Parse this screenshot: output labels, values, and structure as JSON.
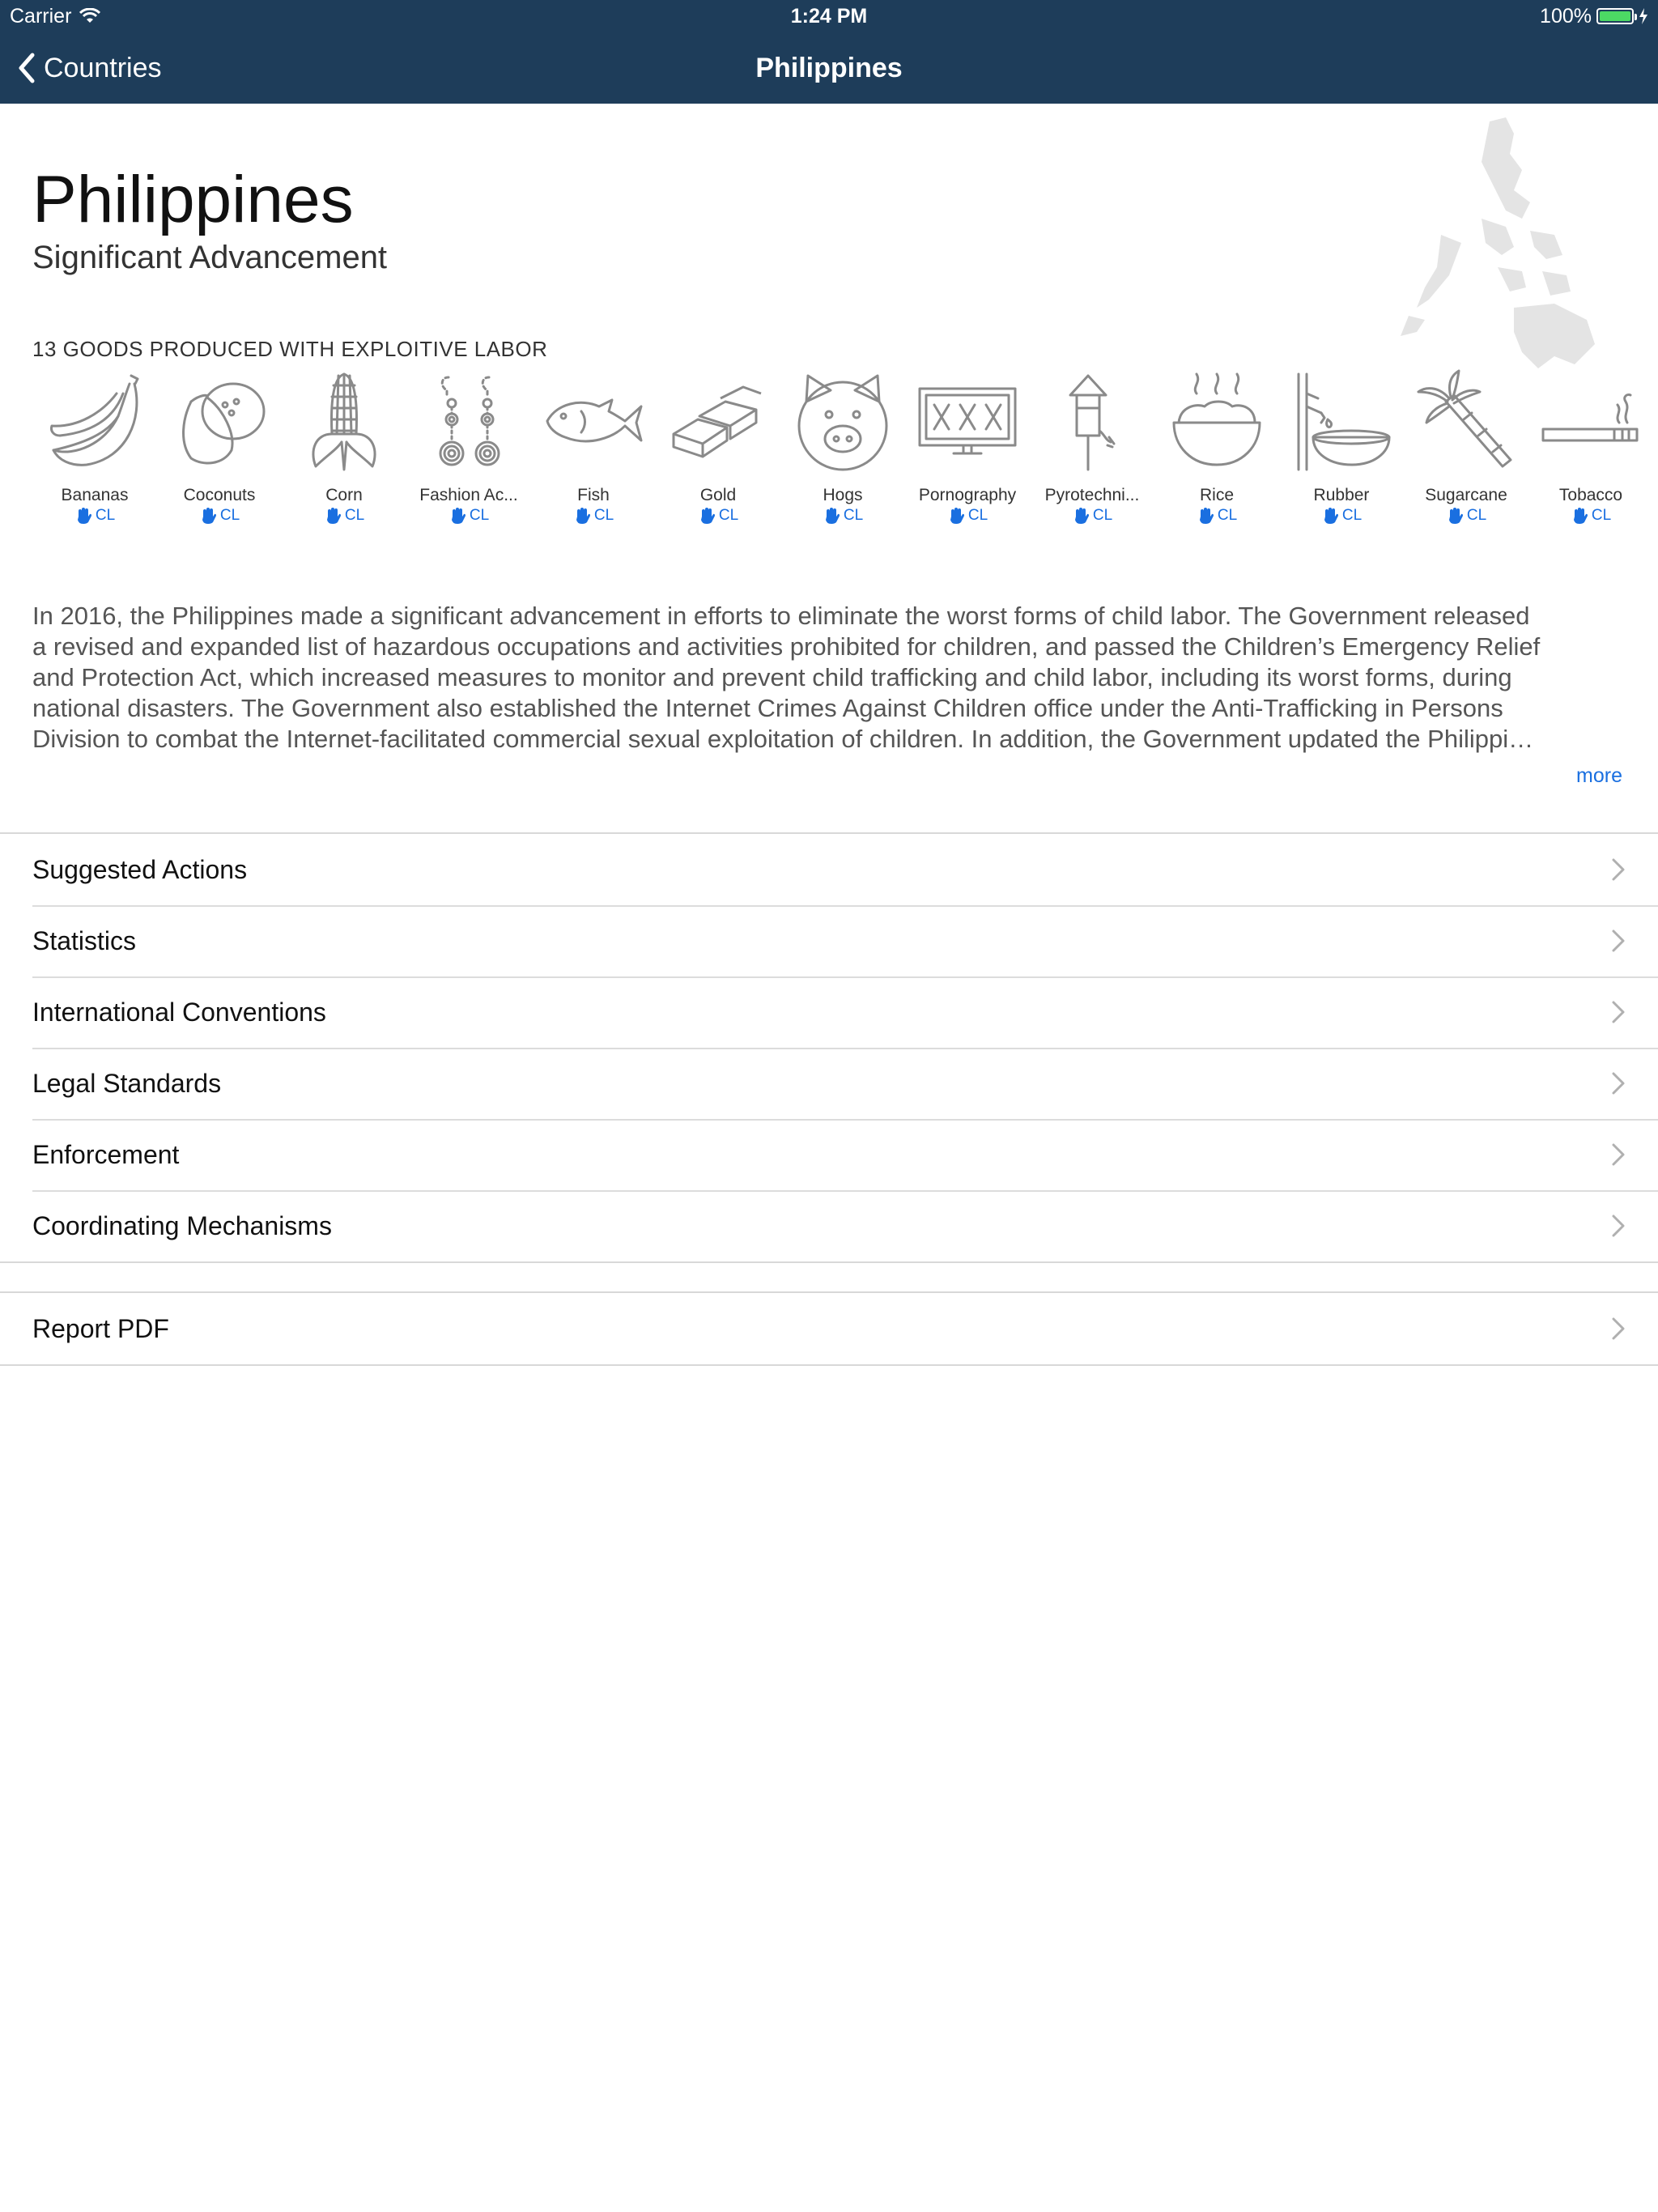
{
  "status_bar": {
    "carrier": "Carrier",
    "time": "1:24 PM",
    "battery": "100%"
  },
  "nav": {
    "back_label": "Countries",
    "title": "Philippines"
  },
  "country": {
    "name": "Philippines",
    "assessment": "Significant Advancement",
    "goods_heading": "13 GOODS PRODUCED WITH EXPLOITIVE LABOR"
  },
  "goods": [
    {
      "label": "Bananas",
      "badge": "CL",
      "icon": "banana-icon"
    },
    {
      "label": "Coconuts",
      "badge": "CL",
      "icon": "coconut-icon"
    },
    {
      "label": "Corn",
      "badge": "CL",
      "icon": "corn-icon"
    },
    {
      "label": "Fashion Ac...",
      "badge": "CL",
      "icon": "earrings-icon"
    },
    {
      "label": "Fish",
      "badge": "CL",
      "icon": "fish-icon"
    },
    {
      "label": "Gold",
      "badge": "CL",
      "icon": "gold-bars-icon"
    },
    {
      "label": "Hogs",
      "badge": "CL",
      "icon": "pig-icon"
    },
    {
      "label": "Pornography",
      "badge": "CL",
      "icon": "xxx-screen-icon"
    },
    {
      "label": "Pyrotechni...",
      "badge": "CL",
      "icon": "firework-icon"
    },
    {
      "label": "Rice",
      "badge": "CL",
      "icon": "rice-bowl-icon"
    },
    {
      "label": "Rubber",
      "badge": "CL",
      "icon": "rubber-tap-icon"
    },
    {
      "label": "Sugarcane",
      "badge": "CL",
      "icon": "sugarcane-icon"
    },
    {
      "label": "Tobacco",
      "badge": "CL",
      "icon": "cigarette-icon"
    }
  ],
  "summary": {
    "lines": [
      "In 2016, the Philippines made a significant advancement in efforts to eliminate the worst forms of child labor. The Government released",
      "a revised and expanded list of hazardous occupations and activities prohibited for children, and passed the Children’s Emergency Relief",
      "and Protection Act, which increased measures to monitor and prevent child trafficking and child labor, including its worst forms, during",
      "national disasters. The Government also established the Internet Crimes Against Children office under the Anti-Trafficking in Persons",
      "Division to combat the Internet-facilitated commercial sexual exploitation of children. In addition, the Government updated the Philippi…"
    ],
    "more_label": "more"
  },
  "sections": [
    "Suggested Actions",
    "Statistics",
    "International Conventions",
    "Legal Standards",
    "Enforcement",
    "Coordinating Mechanisms"
  ],
  "report": {
    "label": "Report PDF"
  },
  "colors": {
    "nav": "#1e3d5a",
    "link": "#1a6fe0",
    "icon_stroke": "#8a8a8a"
  }
}
